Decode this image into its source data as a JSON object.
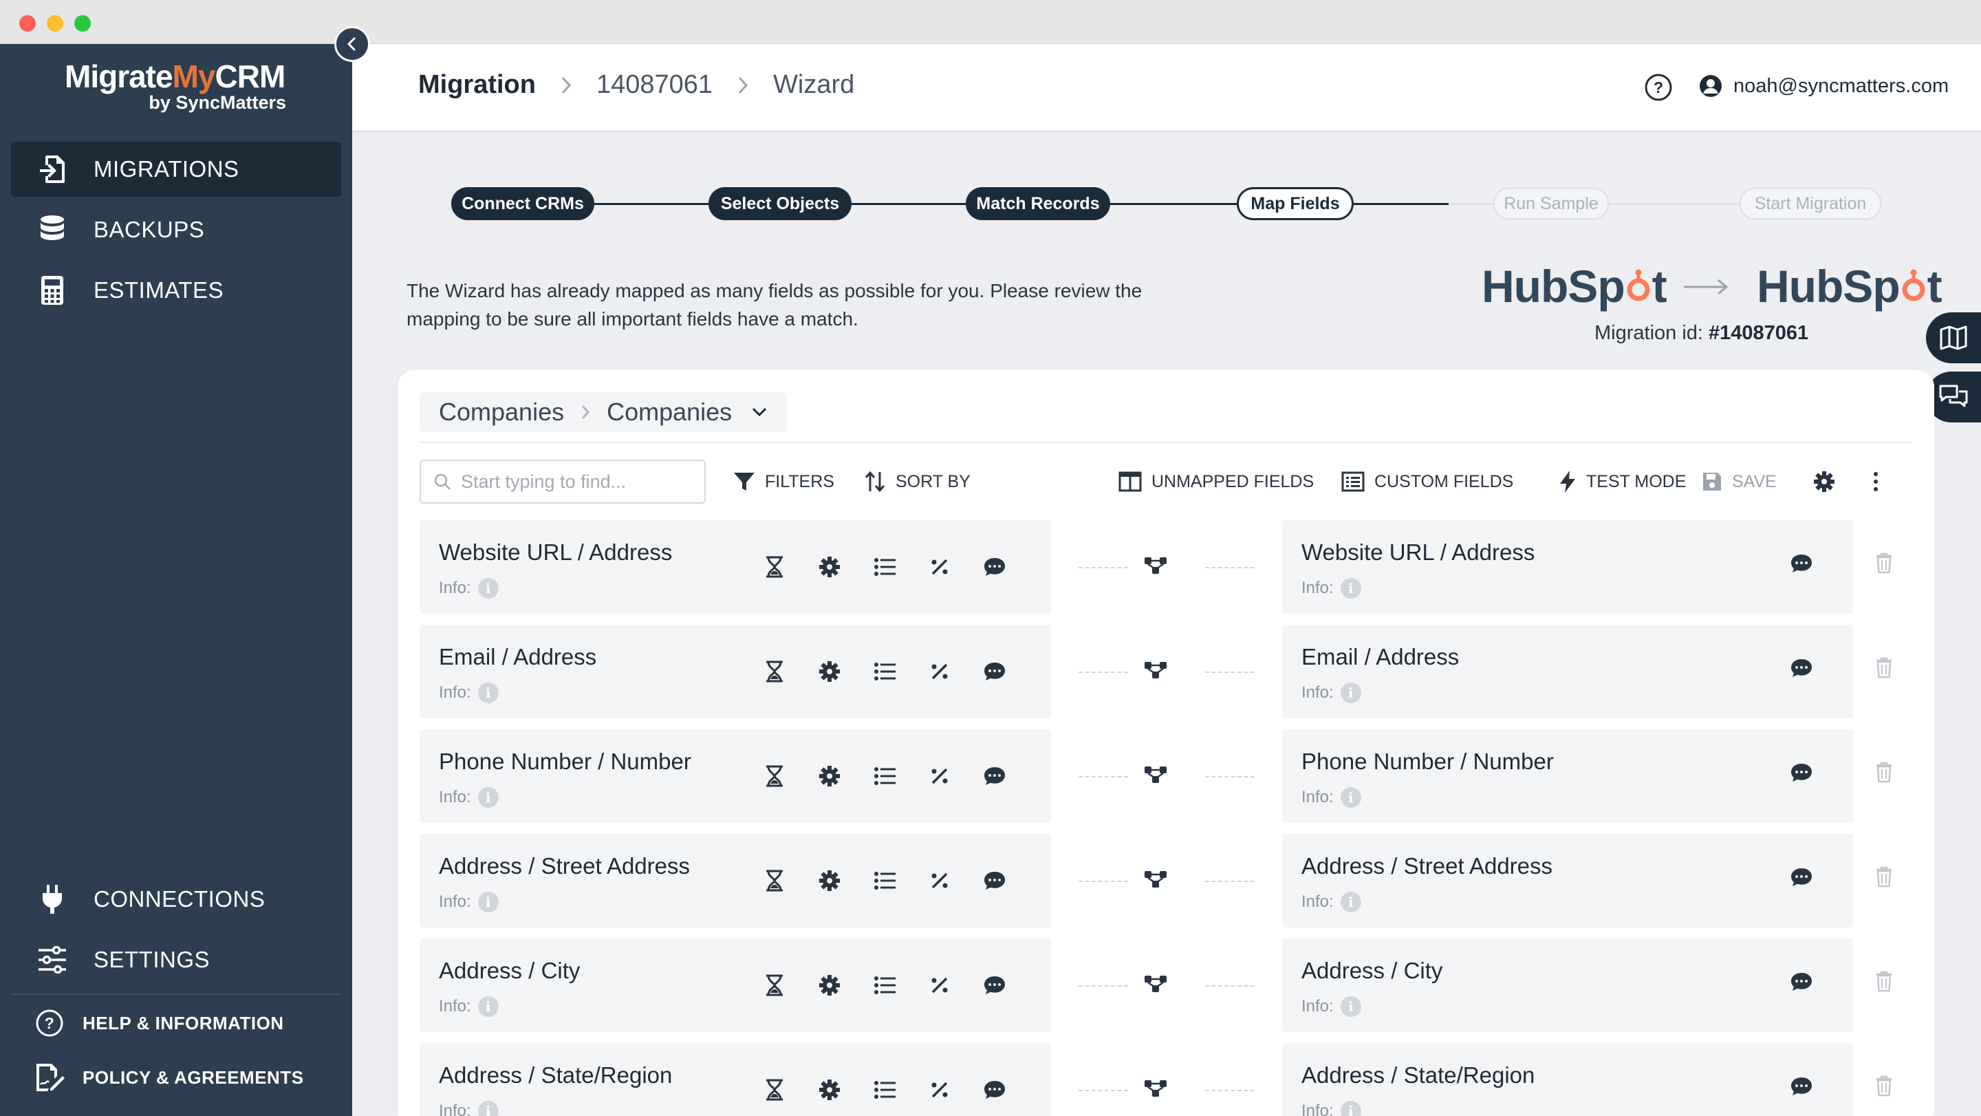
{
  "app": {
    "logo_main_a": "Migrate",
    "logo_main_b": "My",
    "logo_main_c": "CRM",
    "logo_sub": "by SyncMatters"
  },
  "sidebar": {
    "items": [
      {
        "label": "MIGRATIONS",
        "icon": "file-import-icon",
        "active": true
      },
      {
        "label": "BACKUPS",
        "icon": "database-icon",
        "active": false
      },
      {
        "label": "ESTIMATES",
        "icon": "calculator-icon",
        "active": false
      }
    ],
    "bottom_items": [
      {
        "label": "CONNECTIONS",
        "icon": "plug-icon"
      },
      {
        "label": "SETTINGS",
        "icon": "sliders-icon"
      }
    ],
    "footer_items": [
      {
        "label": "HELP & INFORMATION",
        "icon": "help-circle-icon"
      },
      {
        "label": "POLICY & AGREEMENTS",
        "icon": "document-sign-icon"
      }
    ]
  },
  "header": {
    "breadcrumb": [
      "Migration",
      "14087061",
      "Wizard"
    ],
    "user_email": "noah@syncmatters.com"
  },
  "stepper": {
    "steps": [
      {
        "label": "Connect CRMs",
        "state": "done"
      },
      {
        "label": "Select Objects",
        "state": "done"
      },
      {
        "label": "Match Records",
        "state": "done"
      },
      {
        "label": "Map Fields",
        "state": "current"
      },
      {
        "label": "Run Sample",
        "state": "todo"
      },
      {
        "label": "Start Migration",
        "state": "todo"
      }
    ]
  },
  "intro": {
    "text": "The Wizard has already mapped as many fields as possible for you. Please review the mapping to be sure all important fields have a match."
  },
  "platforms": {
    "source_a": "HubSp",
    "source_b": "t",
    "target_a": "HubSp",
    "target_b": "t",
    "migration_id_label": "Migration id:",
    "migration_id_value": "#14087061"
  },
  "mapping": {
    "source_object": "Companies",
    "target_object": "Companies",
    "search_placeholder": "Start typing to find...",
    "toolbar": {
      "filters": "FILTERS",
      "sort_by": "SORT BY",
      "unmapped_fields": "UNMAPPED FIELDS",
      "custom_fields": "CUSTOM FIELDS",
      "test_mode": "TEST MODE",
      "save": "SAVE"
    },
    "info_label": "Info:",
    "rows": [
      {
        "source": "Website URL / Address",
        "target": "Website URL / Address"
      },
      {
        "source": "Email / Address",
        "target": "Email / Address"
      },
      {
        "source": "Phone Number / Number",
        "target": "Phone Number / Number"
      },
      {
        "source": "Address / Street Address",
        "target": "Address / Street Address"
      },
      {
        "source": "Address / City",
        "target": "Address / City"
      },
      {
        "source": "Address / State/Region",
        "target": "Address / State/Region"
      }
    ]
  },
  "colors": {
    "sidebar_bg": "#2c3e50",
    "sidebar_active": "#1d2a38",
    "hubspot_orange": "#ff7a59",
    "brand_orange": "#e8743b",
    "step_dark": "#1c2b3a"
  }
}
